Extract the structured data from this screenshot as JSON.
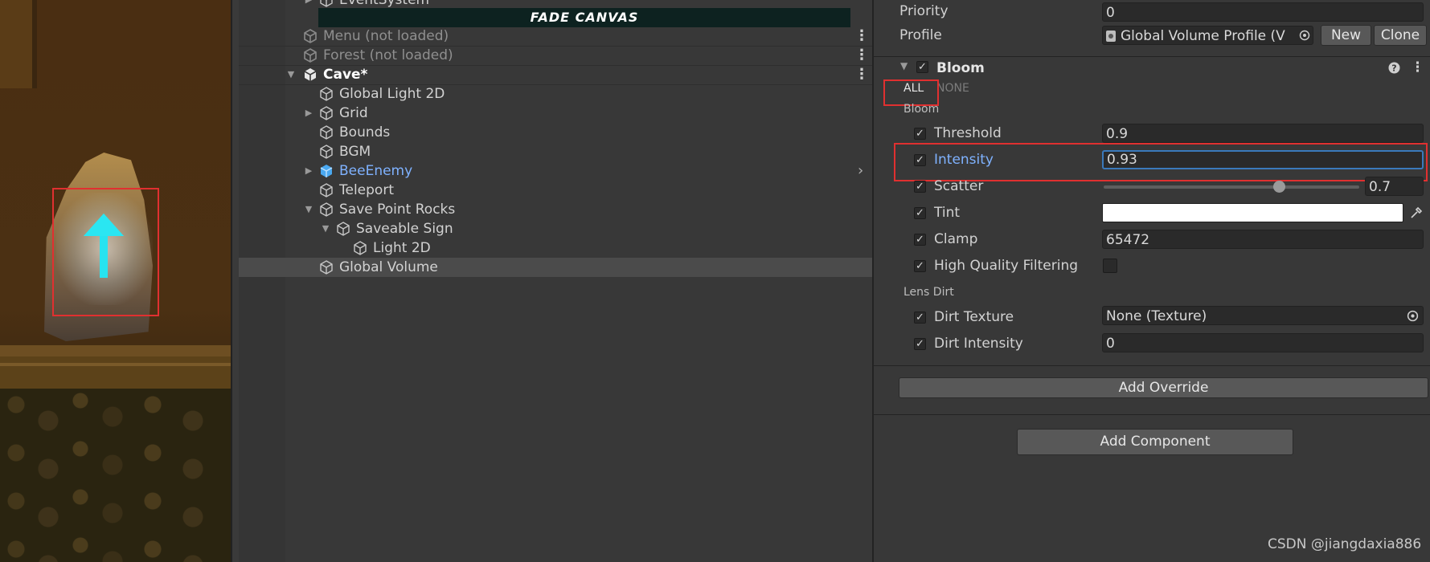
{
  "hierarchy": {
    "items": [
      {
        "label": "EventSystem"
      },
      {
        "label": "FADE CANVAS"
      },
      {
        "label": "Menu (not loaded)"
      },
      {
        "label": "Forest (not loaded)"
      },
      {
        "label": "Cave*"
      },
      {
        "label": "Global Light 2D"
      },
      {
        "label": "Grid"
      },
      {
        "label": "Bounds"
      },
      {
        "label": "BGM"
      },
      {
        "label": "BeeEnemy"
      },
      {
        "label": "Teleport"
      },
      {
        "label": "Save Point Rocks"
      },
      {
        "label": "Saveable Sign"
      },
      {
        "label": "Light 2D"
      },
      {
        "label": "Global Volume"
      }
    ]
  },
  "inspector": {
    "priority_label": "Priority",
    "priority_value": "0",
    "profile_label": "Profile",
    "profile_value": "Global Volume Profile (V",
    "new_label": "New",
    "clone_label": "Clone",
    "bloom_title": "Bloom",
    "all_label": "ALL",
    "none_label": "NONE",
    "bloom_section": "Bloom",
    "threshold_label": "Threshold",
    "threshold_value": "0.9",
    "intensity_label": "Intensity",
    "intensity_value": "0.93",
    "scatter_label": "Scatter",
    "scatter_value": "0.7",
    "tint_label": "Tint",
    "tint_color": "#ffffff",
    "clamp_label": "Clamp",
    "clamp_value": "65472",
    "hq_label": "High Quality Filtering",
    "lens_section": "Lens Dirt",
    "dirt_texture_label": "Dirt Texture",
    "dirt_texture_value": "None (Texture)",
    "dirt_intensity_label": "Dirt Intensity",
    "dirt_intensity_value": "0",
    "add_override_label": "Add Override",
    "add_component_label": "Add Component"
  },
  "watermark": "CSDN @jiangdaxia886",
  "colors": {
    "highlight": "#e03030",
    "prefab": "#7fb2ff",
    "focus": "#3a79bb"
  }
}
